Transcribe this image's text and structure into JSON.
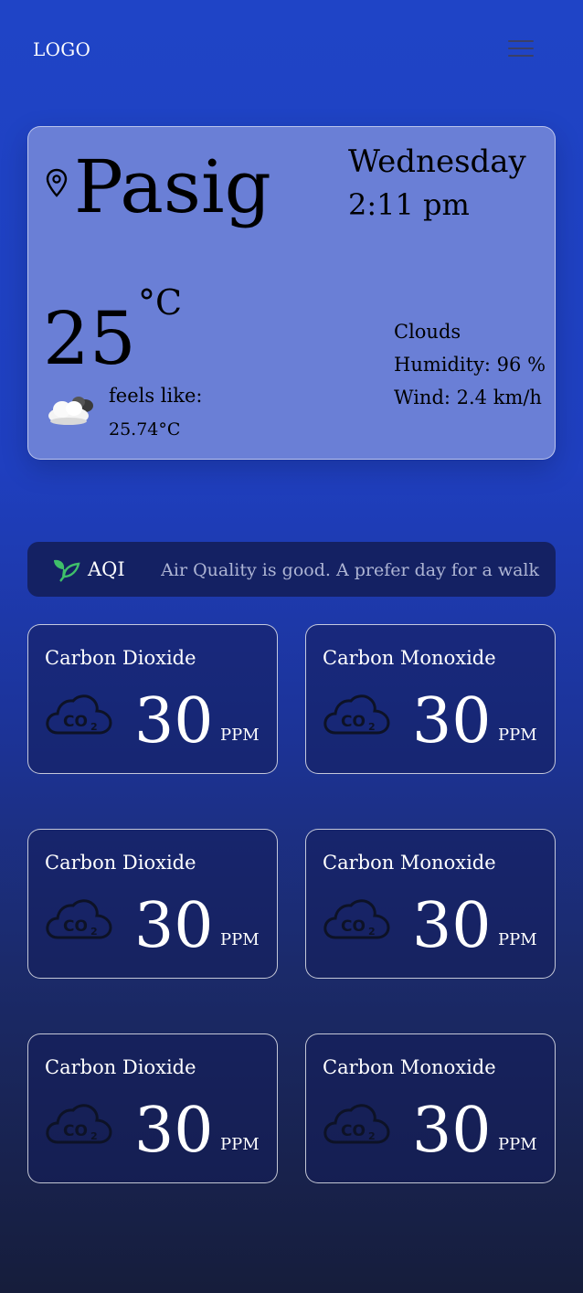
{
  "header": {
    "logo": "LOGO",
    "menu_icon": "hamburger-menu-icon"
  },
  "weather": {
    "city": "Pasig",
    "day": "Wednesday",
    "time": "2:11 pm",
    "temperature": "25",
    "unit": "°C",
    "feels_like_label": "feels like:",
    "feels_like_value": "25.74°C",
    "condition": "Clouds",
    "humidity": "Humidity: 96 %",
    "wind": "Wind: 2.4 km/h",
    "condition_icon": "cloud-sun-icon",
    "location_icon": "location-pin-icon"
  },
  "aqi": {
    "label": "AQI",
    "message": "Air Quality is good. A prefer day for a walk",
    "icon": "leaf-icon",
    "icon_color": "#3fbf6a"
  },
  "gases": [
    {
      "name": "Carbon Dioxide",
      "value": "30",
      "unit": "PPM",
      "icon": "co2-cloud-icon"
    },
    {
      "name": "Carbon Monoxide",
      "value": "30",
      "unit": "PPM",
      "icon": "co2-cloud-icon"
    },
    {
      "name": "Carbon Dioxide",
      "value": "30",
      "unit": "PPM",
      "icon": "co2-cloud-icon"
    },
    {
      "name": "Carbon Monoxide",
      "value": "30",
      "unit": "PPM",
      "icon": "co2-cloud-icon"
    },
    {
      "name": "Carbon Dioxide",
      "value": "30",
      "unit": "PPM",
      "icon": "co2-cloud-icon"
    },
    {
      "name": "Carbon Monoxide",
      "value": "30",
      "unit": "PPM",
      "icon": "co2-cloud-icon"
    }
  ]
}
